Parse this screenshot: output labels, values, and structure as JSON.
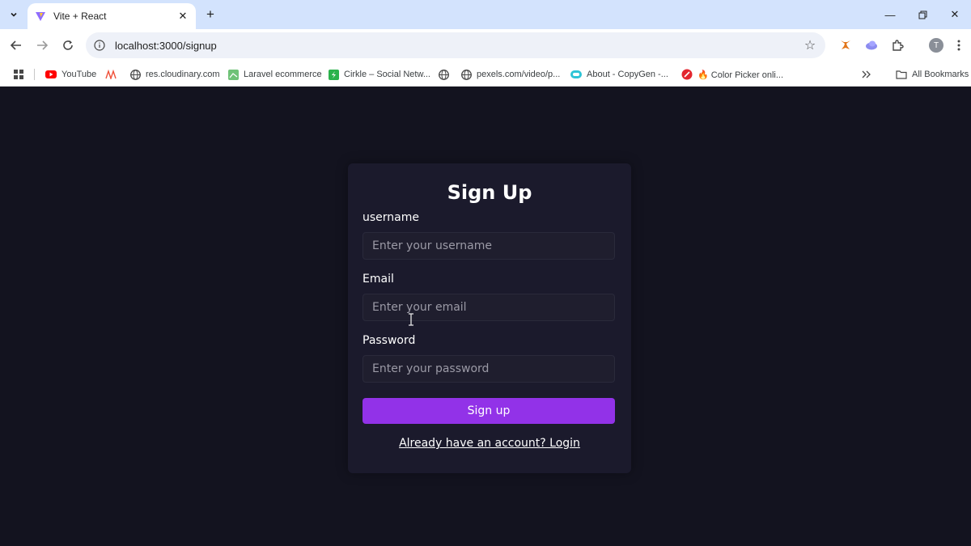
{
  "browser": {
    "tab_title": "Vite + React",
    "url": "localhost:3000/signup",
    "avatar_letter": "T",
    "bookmarks": [
      {
        "label": "YouTube",
        "icon": "youtube-icon"
      },
      {
        "label": "",
        "icon": "laravel-icon"
      },
      {
        "label": "res.cloudinary.com",
        "icon": "globe-icon"
      },
      {
        "label": "Laravel ecommerce",
        "icon": "map-icon"
      },
      {
        "label": "Cirkle – Social Netw...",
        "icon": "cirkle-icon"
      },
      {
        "label": "",
        "icon": "globe-icon"
      },
      {
        "label": "pexels.com/video/p...",
        "icon": "globe-icon"
      },
      {
        "label": "About - CopyGen -...",
        "icon": "copygen-icon"
      },
      {
        "label": "🔥 Color Picker onli...",
        "icon": "color-picker-icon"
      }
    ],
    "all_bookmarks": "All Bookmarks"
  },
  "signup": {
    "title": "Sign Up",
    "username_label": "username",
    "username_placeholder": "Enter your username",
    "email_label": "Email",
    "email_placeholder": "Enter your email",
    "password_label": "Password",
    "password_placeholder": "Enter your password",
    "submit_label": "Sign up",
    "login_link": "Already have an account? Login"
  },
  "colors": {
    "page_bg": "#13131f",
    "card_bg": "#1b1a2c",
    "accent": "#9232e8",
    "tabstrip_bg": "#d3e3fd"
  }
}
